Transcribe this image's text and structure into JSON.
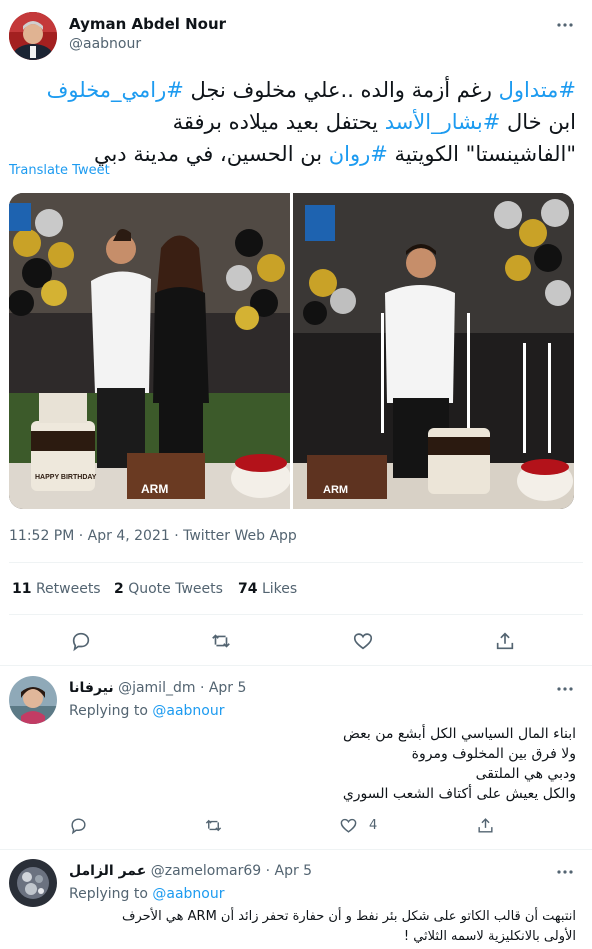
{
  "tweet": {
    "author_name": "Ayman Abdel Nour",
    "author_handle": "@aabnour",
    "line1": {
      "tag1": "#متداول",
      "text": " رغم أزمة والده ..علي مخلوف نجل ",
      "tag2": "#رامي_مخلوف"
    },
    "line2": {
      "text1": "ابن خال ",
      "tag": "#بشار_الأسد",
      "text2": " يحتفل بعيد ميلاده برفقة"
    },
    "line3": {
      "text1": "\"الفاشينستا\" الكويتية ",
      "tag": "#روان",
      "text2": " بن الحسين، في مدينة دبي"
    },
    "translate_label": "Translate Tweet",
    "timestamp": "11:52 PM · Apr 4, 2021 · Twitter Web App",
    "cake_label": "ARM",
    "birthday_label": "HAPPY BIRTHDAY",
    "stats": {
      "retweets_count": "11",
      "retweets_label": "Retweets",
      "quotes_count": "2",
      "quotes_label": "Quote Tweets",
      "likes_count": "74",
      "likes_label": "Likes"
    }
  },
  "replies": [
    {
      "name": "نيرفانا",
      "handle": "@jamil_dm · Apr 5",
      "replying_prefix": "Replying to ",
      "replying_to": "@aabnour",
      "lines": [
        "ابناء المال السياسي الكل أبشع من بعض",
        "ولا فرق بين المخلوف ومروة",
        "ودبي هي الملتقى",
        "والكل يعيش على أكتاف الشعب السوري"
      ],
      "likes": "4"
    },
    {
      "name": "عمر الزامل",
      "handle": "@zamelomar69 · Apr 5",
      "replying_prefix": "Replying to ",
      "replying_to": "@aabnour",
      "lines": [
        "انتبهت أن قالب الكاتو على شكل بئر نفط و أن حفارة تحفر زائد أن ARM هي الأحرف",
        "الأولى بالانكليزية لاسمه الثلاثي !"
      ],
      "likes": ""
    }
  ]
}
